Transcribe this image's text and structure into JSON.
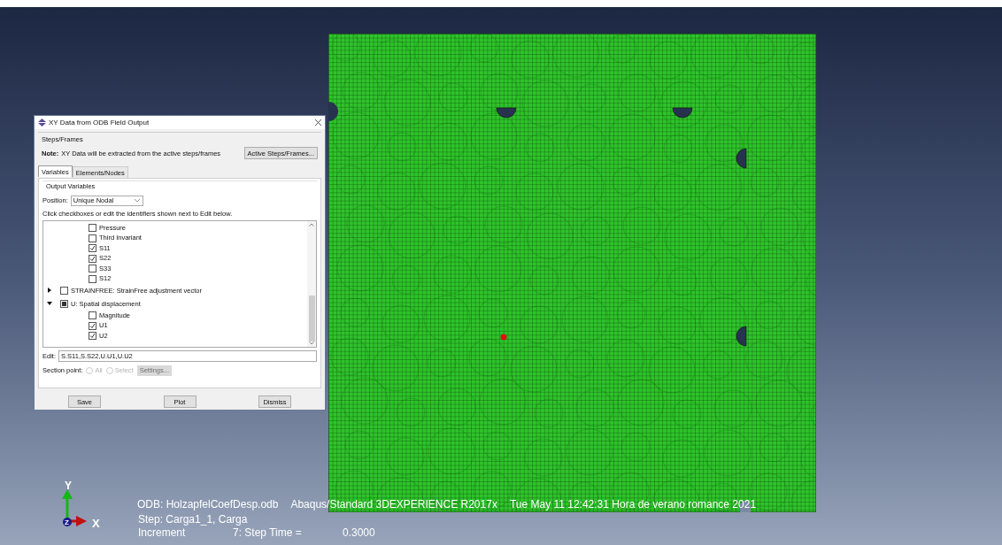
{
  "dialog": {
    "title": "XY Data from ODB Field Output",
    "steps_frames": {
      "group_label": "Steps/Frames",
      "note_label": "Note:",
      "note": "XY Data will be extracted from the active steps/frames",
      "button": "Active Steps/Frames..."
    },
    "tabs": [
      {
        "label": "Variables",
        "selected": true
      },
      {
        "label": "Elements/Nodes",
        "selected": false
      }
    ],
    "output_variables": {
      "group_label": "Output Variables",
      "position_label": "Position:",
      "position_value": "Unique Nodal",
      "instruction": "Click checkboxes or edit the identifiers shown next to Edit below.",
      "scrolled_children": [
        {
          "label": "Pressure",
          "checked": false
        },
        {
          "label": "Third Invariant",
          "checked": false
        },
        {
          "label": "S11",
          "checked": true
        },
        {
          "label": "S22",
          "checked": true
        },
        {
          "label": "S33",
          "checked": false
        },
        {
          "label": "S12",
          "checked": false
        }
      ],
      "nodes": [
        {
          "label": "STRAINFREE: StrainFree adjustment vector",
          "expanded": false,
          "partially_checked": false
        },
        {
          "label": "U: Spatial displacement",
          "expanded": true,
          "partially_checked": true,
          "children": [
            {
              "label": "Magnitude",
              "checked": false
            },
            {
              "label": "U1",
              "checked": true
            },
            {
              "label": "U2",
              "checked": true
            }
          ]
        }
      ],
      "edit_label": "Edit:",
      "edit_value": "S.S11,S.S22,U.U1,U.U2",
      "section_point": {
        "label": "Section point:",
        "disabled": true,
        "options": [
          {
            "label": "All",
            "selected": false
          },
          {
            "label": "Select",
            "selected": false
          }
        ],
        "settings_button": "Settings..."
      }
    },
    "buttons": [
      "Save",
      "Plot",
      "Dismiss"
    ]
  },
  "viewport": {
    "triad": {
      "y": "Y",
      "x": "X",
      "z": "Z"
    },
    "info_line": [
      "ODB: HolzapfelCoefDesp.odb",
      "Abaqus/Standard 3DEXPERIENCE R2017x",
      "Tue May 11 12:42:31 Hora de verano romance 2021"
    ],
    "step_line": "Step: Carga1_1, Carga",
    "increment": {
      "label": "Increment",
      "frame": "7: Step Time =",
      "value": "0.3000"
    }
  }
}
